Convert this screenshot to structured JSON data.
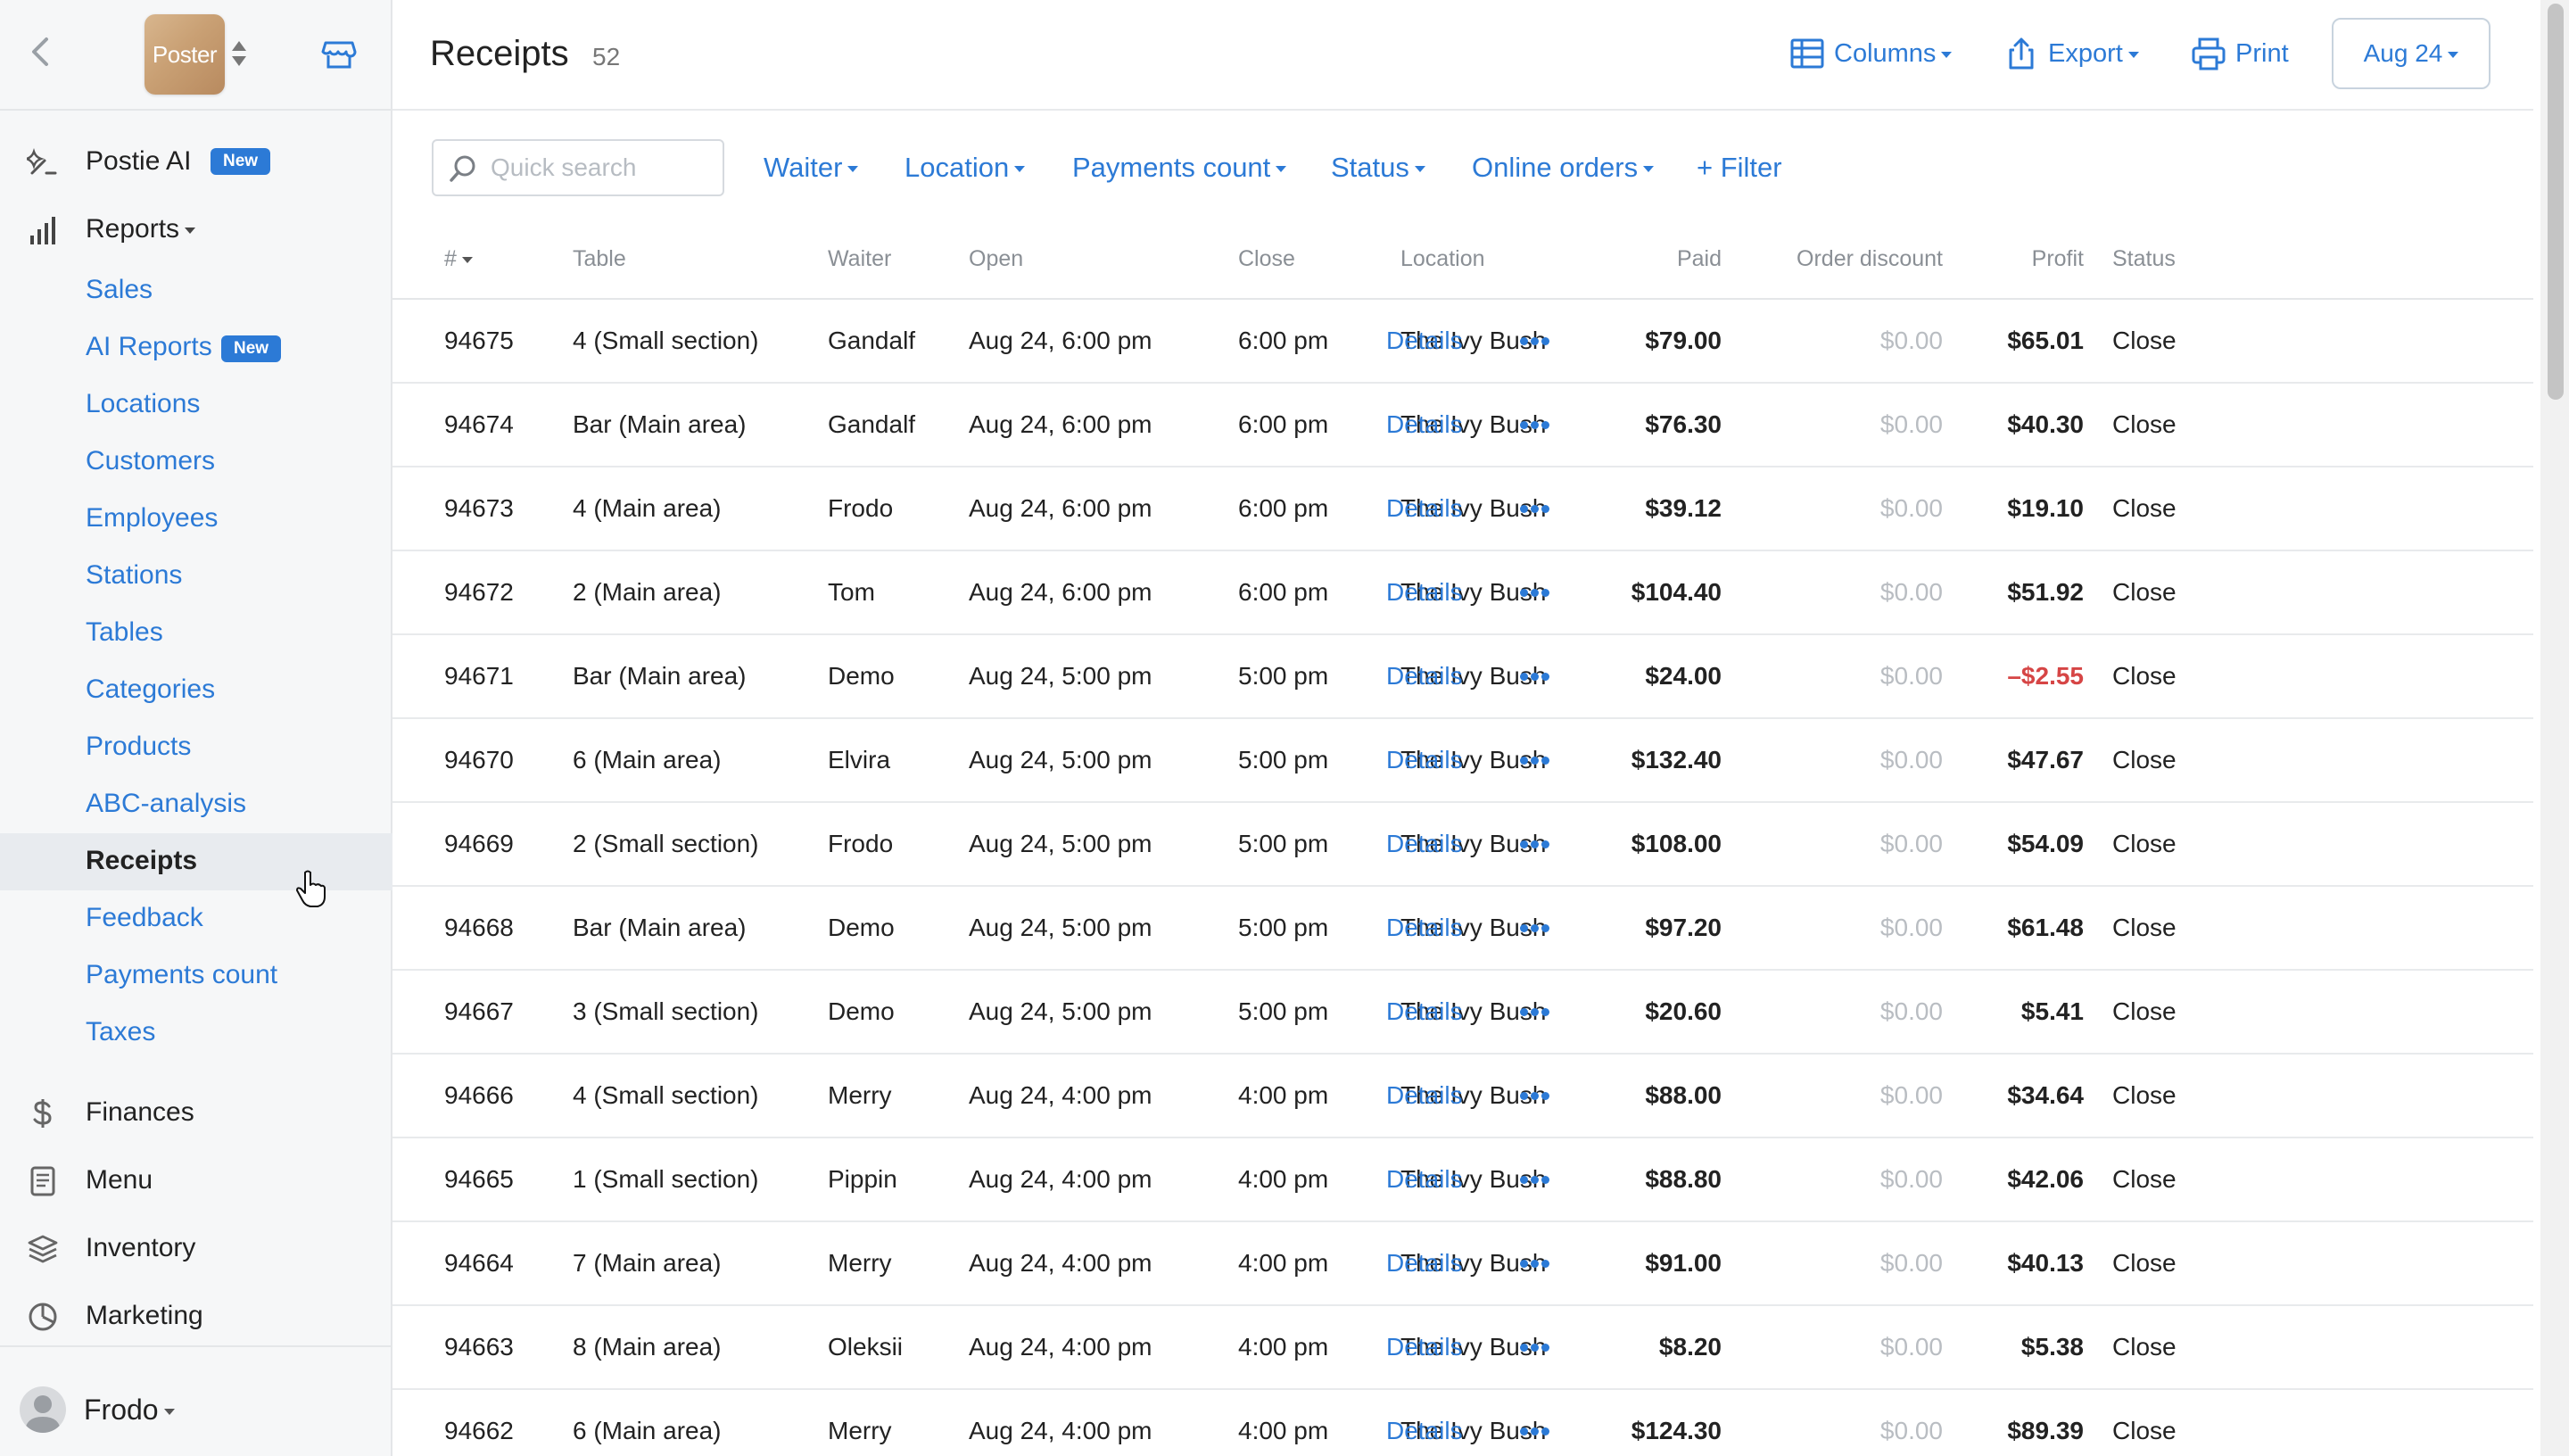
{
  "sidebar": {
    "logo_text": "Poster",
    "primary": [
      {
        "label": "Postie AI",
        "badge": "New",
        "icon": "sparkle-icon"
      },
      {
        "label": "Reports",
        "icon": "bar-chart-icon"
      }
    ],
    "report_items": [
      {
        "label": "Sales"
      },
      {
        "label": "AI Reports",
        "badge": "New"
      },
      {
        "label": "Locations"
      },
      {
        "label": "Customers"
      },
      {
        "label": "Employees"
      },
      {
        "label": "Stations"
      },
      {
        "label": "Tables"
      },
      {
        "label": "Categories"
      },
      {
        "label": "Products"
      },
      {
        "label": "ABC-analysis"
      },
      {
        "label": "Receipts",
        "active": true
      },
      {
        "label": "Feedback"
      },
      {
        "label": "Payments count"
      },
      {
        "label": "Taxes"
      }
    ],
    "secondary": [
      {
        "label": "Finances",
        "icon": "dollar-icon"
      },
      {
        "label": "Menu",
        "icon": "document-icon"
      },
      {
        "label": "Inventory",
        "icon": "layers-icon"
      },
      {
        "label": "Marketing",
        "icon": "pie-icon"
      }
    ],
    "user": {
      "name": "Frodo"
    }
  },
  "header": {
    "title": "Receipts",
    "count": "52",
    "columns_label": "Columns",
    "export_label": "Export",
    "print_label": "Print",
    "date_label": "Aug 24"
  },
  "filters": {
    "search_placeholder": "Quick search",
    "waiter": "Waiter",
    "location": "Location",
    "payments_count": "Payments count",
    "status": "Status",
    "online_orders": "Online orders",
    "add_filter": "+ Filter"
  },
  "table": {
    "columns": {
      "id": "#",
      "table": "Table",
      "waiter": "Waiter",
      "open": "Open",
      "close": "Close",
      "location": "Location",
      "paid": "Paid",
      "order_discount": "Order discount",
      "profit": "Profit",
      "status": "Status"
    },
    "details_label": "Details",
    "rows": [
      {
        "id": "94675",
        "table": "4 (Small section)",
        "waiter": "Gandalf",
        "open": "Aug 24, 6:00 pm",
        "close": "6:00 pm",
        "location": "The Ivy Bush",
        "paid": "$79.00",
        "discount": "$0.00",
        "profit": "$65.01",
        "status": "Close"
      },
      {
        "id": "94674",
        "table": "Bar (Main area)",
        "waiter": "Gandalf",
        "open": "Aug 24, 6:00 pm",
        "close": "6:00 pm",
        "location": "The Ivy Bush",
        "paid": "$76.30",
        "discount": "$0.00",
        "profit": "$40.30",
        "status": "Close"
      },
      {
        "id": "94673",
        "table": "4 (Main area)",
        "waiter": "Frodo",
        "open": "Aug 24, 6:00 pm",
        "close": "6:00 pm",
        "location": "The Ivy Bush",
        "paid": "$39.12",
        "discount": "$0.00",
        "profit": "$19.10",
        "status": "Close"
      },
      {
        "id": "94672",
        "table": "2 (Main area)",
        "waiter": "Tom",
        "open": "Aug 24, 6:00 pm",
        "close": "6:00 pm",
        "location": "The Ivy Bush",
        "paid": "$104.40",
        "discount": "$0.00",
        "profit": "$51.92",
        "status": "Close"
      },
      {
        "id": "94671",
        "table": "Bar (Main area)",
        "waiter": "Demo",
        "open": "Aug 24, 5:00 pm",
        "close": "5:00 pm",
        "location": "The Ivy Bush",
        "paid": "$24.00",
        "discount": "$0.00",
        "profit": "–$2.55",
        "negative": true,
        "status": "Close"
      },
      {
        "id": "94670",
        "table": "6 (Main area)",
        "waiter": "Elvira",
        "open": "Aug 24, 5:00 pm",
        "close": "5:00 pm",
        "location": "The Ivy Bush",
        "paid": "$132.40",
        "discount": "$0.00",
        "profit": "$47.67",
        "status": "Close"
      },
      {
        "id": "94669",
        "table": "2 (Small section)",
        "waiter": "Frodo",
        "open": "Aug 24, 5:00 pm",
        "close": "5:00 pm",
        "location": "The Ivy Bush",
        "paid": "$108.00",
        "discount": "$0.00",
        "profit": "$54.09",
        "status": "Close"
      },
      {
        "id": "94668",
        "table": "Bar (Main area)",
        "waiter": "Demo",
        "open": "Aug 24, 5:00 pm",
        "close": "5:00 pm",
        "location": "The Ivy Bush",
        "paid": "$97.20",
        "discount": "$0.00",
        "profit": "$61.48",
        "status": "Close"
      },
      {
        "id": "94667",
        "table": "3 (Small section)",
        "waiter": "Demo",
        "open": "Aug 24, 5:00 pm",
        "close": "5:00 pm",
        "location": "The Ivy Bush",
        "paid": "$20.60",
        "discount": "$0.00",
        "profit": "$5.41",
        "status": "Close"
      },
      {
        "id": "94666",
        "table": "4 (Small section)",
        "waiter": "Merry",
        "open": "Aug 24, 4:00 pm",
        "close": "4:00 pm",
        "location": "The Ivy Bush",
        "paid": "$88.00",
        "discount": "$0.00",
        "profit": "$34.64",
        "status": "Close"
      },
      {
        "id": "94665",
        "table": "1 (Small section)",
        "waiter": "Pippin",
        "open": "Aug 24, 4:00 pm",
        "close": "4:00 pm",
        "location": "The Ivy Bush",
        "paid": "$88.80",
        "discount": "$0.00",
        "profit": "$42.06",
        "status": "Close"
      },
      {
        "id": "94664",
        "table": "7 (Main area)",
        "waiter": "Merry",
        "open": "Aug 24, 4:00 pm",
        "close": "4:00 pm",
        "location": "The Ivy Bush",
        "paid": "$91.00",
        "discount": "$0.00",
        "profit": "$40.13",
        "status": "Close"
      },
      {
        "id": "94663",
        "table": "8 (Main area)",
        "waiter": "Oleksii",
        "open": "Aug 24, 4:00 pm",
        "close": "4:00 pm",
        "location": "The Ivy Bush",
        "paid": "$8.20",
        "discount": "$0.00",
        "profit": "$5.38",
        "status": "Close"
      },
      {
        "id": "94662",
        "table": "6 (Main area)",
        "waiter": "Merry",
        "open": "Aug 24, 4:00 pm",
        "close": "4:00 pm",
        "location": "The Ivy Bush",
        "paid": "$124.30",
        "discount": "$0.00",
        "profit": "$89.39",
        "status": "Close"
      }
    ]
  },
  "colors": {
    "accent": "#2c7ad6",
    "negative": "#d64545",
    "muted": "#b9bdc2",
    "sidebar_bg": "#f6f7f8"
  }
}
